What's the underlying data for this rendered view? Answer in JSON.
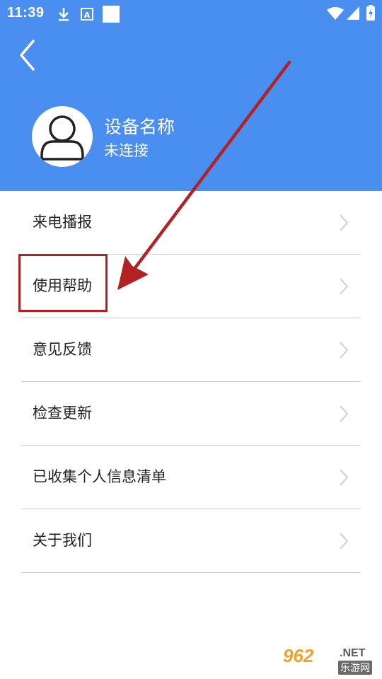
{
  "status_bar": {
    "time": "11:39",
    "icons": [
      "download-icon",
      "app-notification-icon",
      "square-notification-icon",
      "wifi-icon",
      "signal-icon",
      "battery-charging-icon"
    ]
  },
  "header": {
    "back_icon": "chevron-left-icon",
    "avatar_icon": "user-icon",
    "device_name": "设备名称",
    "device_status": "未连接",
    "background_color": "#4a8ef0"
  },
  "menu": {
    "items": [
      {
        "label": "来电播报"
      },
      {
        "label": "使用帮助"
      },
      {
        "label": "意见反馈"
      },
      {
        "label": "检查更新"
      },
      {
        "label": "已收集个人信息清单"
      },
      {
        "label": "关于我们"
      }
    ],
    "chevron_icon": "chevron-right-icon"
  },
  "annotation": {
    "highlight_color": "#b22222",
    "highlighted_item": "使用帮助"
  },
  "watermark": {
    "brand": "962",
    "domain": ".NET",
    "subtitle": "乐游网"
  }
}
